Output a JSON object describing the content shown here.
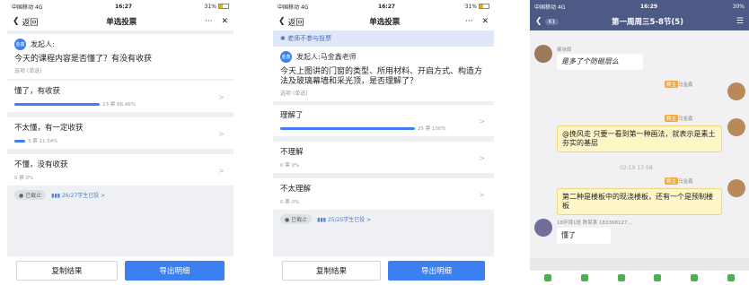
{
  "p1": {
    "status": {
      "carrier": "中国移动 4G",
      "time": "16:27",
      "battery": "31%"
    },
    "nav": {
      "back": "返回",
      "title": "单选投票",
      "more": "···",
      "close": "✕"
    },
    "initiator": {
      "avatar": "金鑫",
      "label": "发起人:"
    },
    "question": "今天的课程内容是否懂了？有没有收获",
    "question_type": "选项 (单选)",
    "options": [
      {
        "label": "懂了，有收获",
        "count": "23 票 88.46%",
        "pct": 88.46
      },
      {
        "label": "不太懂，有一定收获",
        "count": "3 票 11.54%",
        "pct": 11.54
      },
      {
        "label": "不懂，没有收获",
        "count": "0 票 0%",
        "pct": 0
      }
    ],
    "footer": {
      "ended": "已截止",
      "joined": "26/27学生已投 >"
    },
    "buttons": {
      "copy": "复制结果",
      "export": "导出明细"
    }
  },
  "p2": {
    "status": {
      "carrier": "中国移动 4G",
      "time": "16:27",
      "battery": "31%"
    },
    "nav": {
      "back": "返回",
      "title": "单选投票",
      "more": "···",
      "close": "✕"
    },
    "notice": "老师不参与投票",
    "initiator": {
      "avatar": "金鑫",
      "label": "发起人:马金鑫老师"
    },
    "question": "今天上图讲的门窗的类型、所用材料、开启方式、构造方法及玻璃幕墙和采光顶，是否理解了？",
    "question_type": "选项 (单选)",
    "options": [
      {
        "label": "理解了",
        "count": "25 票 100%",
        "pct": 100
      },
      {
        "label": "不理解",
        "count": "0 票 0%",
        "pct": 0
      },
      {
        "label": "不太理解",
        "count": "0 票 0%",
        "pct": 0
      }
    ],
    "footer": {
      "ended": "已截止",
      "joined": "25/25学生已投 >"
    },
    "buttons": {
      "copy": "复制结果",
      "export": "导出明细"
    }
  },
  "p3": {
    "status": {
      "carrier": "中国移动 4G",
      "time": "16:29",
      "battery": "30%"
    },
    "nav": {
      "badge": "61",
      "title": "第一周周三5-8节(5)"
    },
    "messages": [
      {
        "name": "侯冰辉",
        "text": "是多了个防砸层么"
      },
      {
        "tag": "群主",
        "name": "马金鑫"
      },
      {
        "tag": "群主",
        "name": "马金鑫",
        "text": "@挽风走 只要一看到第一种画法，就表示是素土夯实的基层"
      },
      {
        "time": "02-19 17:58"
      },
      {
        "tag": "群主",
        "name": "马金鑫",
        "text": "第二种是楼板中的现浇楼板，还有一个是预制楼板"
      },
      {
        "name": "18环境1班 陈某某 183368127...",
        "text": "懂了"
      }
    ]
  }
}
